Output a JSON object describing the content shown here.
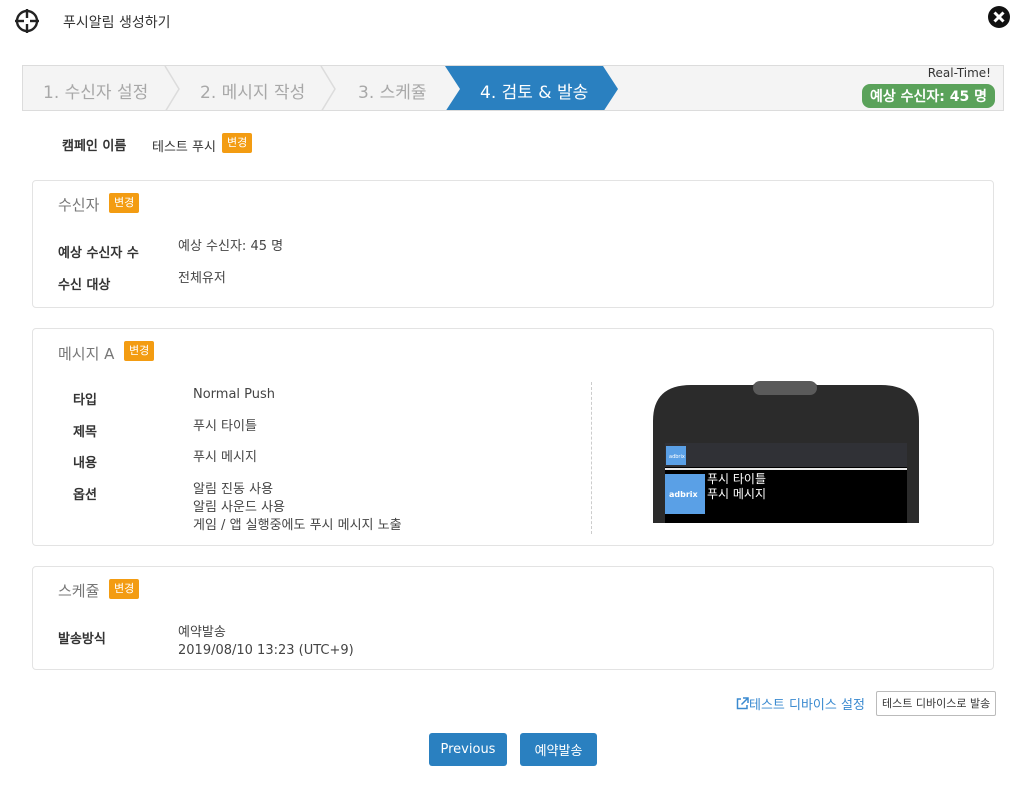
{
  "modal": {
    "title": "푸시알림 생성하기"
  },
  "steps": [
    {
      "label": "1. 수신자 설정",
      "active": false
    },
    {
      "label": "2. 메시지 작성",
      "active": false
    },
    {
      "label": "3. 스케쥴",
      "active": false
    },
    {
      "label": "4. 검토 & 발송",
      "active": true
    }
  ],
  "realtime": {
    "label": "Real-Time!",
    "estimate": "예상 수신자: 45 명"
  },
  "campaign": {
    "label": "캠페인 이름",
    "value": "테스트 푸시",
    "edit": "변경"
  },
  "recipients": {
    "title": "수신자",
    "edit": "변경",
    "rows": [
      {
        "label": "예상 수신자 수",
        "value": "예상 수신자: 45 명"
      },
      {
        "label": "수신 대상",
        "value": "전체유저"
      }
    ]
  },
  "message": {
    "title": "메시지 A",
    "edit": "변경",
    "type_label": "타입",
    "type_value": "Normal Push",
    "subject_label": "제목",
    "subject_value": "푸시 타이틀",
    "content_label": "내용",
    "content_value": "푸시 메시지",
    "options_label": "옵션",
    "options": [
      "알림 진동 사용",
      "알림 사운드 사용",
      "게임 / 앱 실행중에도 푸시 메시지 노출"
    ]
  },
  "preview": {
    "brand": "adbrix",
    "title": "푸시 타이틀",
    "body": "푸시 메시지"
  },
  "schedule": {
    "title": "스케쥴",
    "edit": "변경",
    "method_label": "발송방식",
    "method_value": "예약발송",
    "datetime": "2019/08/10 13:23 (UTC+9)"
  },
  "actions": {
    "test_device_settings": "테스트 디바이스 설정",
    "send_to_test_device": "테스트 디바이스로 발송",
    "previous": "Previous",
    "schedule_send": "예약발송"
  },
  "colors": {
    "accent": "#2a80c0",
    "badge": "#f39c12",
    "success": "#5aa25a"
  }
}
